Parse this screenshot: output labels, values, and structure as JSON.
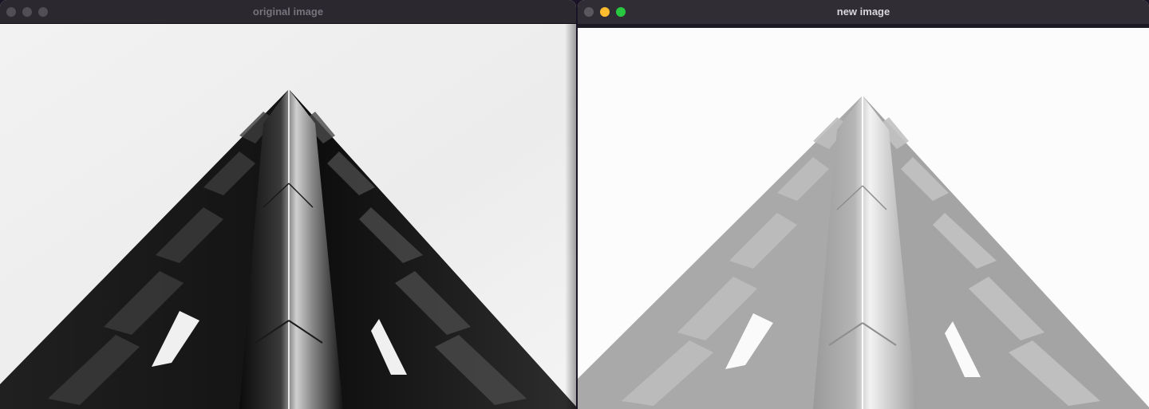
{
  "windows": [
    {
      "title": "original image",
      "focused": false,
      "traffic_lights": [
        "close",
        "minimize",
        "zoom"
      ],
      "image": "grayscale-building-corner-photo"
    },
    {
      "title": "new image",
      "focused": true,
      "traffic_lights": [
        "close",
        "minimize",
        "zoom"
      ],
      "image": "grayscale-building-corner-photo-brightened"
    }
  ],
  "colors": {
    "desktop": "#1b1326",
    "titlebar": "#2c2830",
    "minimize": "#febc2e",
    "zoom": "#28c840"
  }
}
